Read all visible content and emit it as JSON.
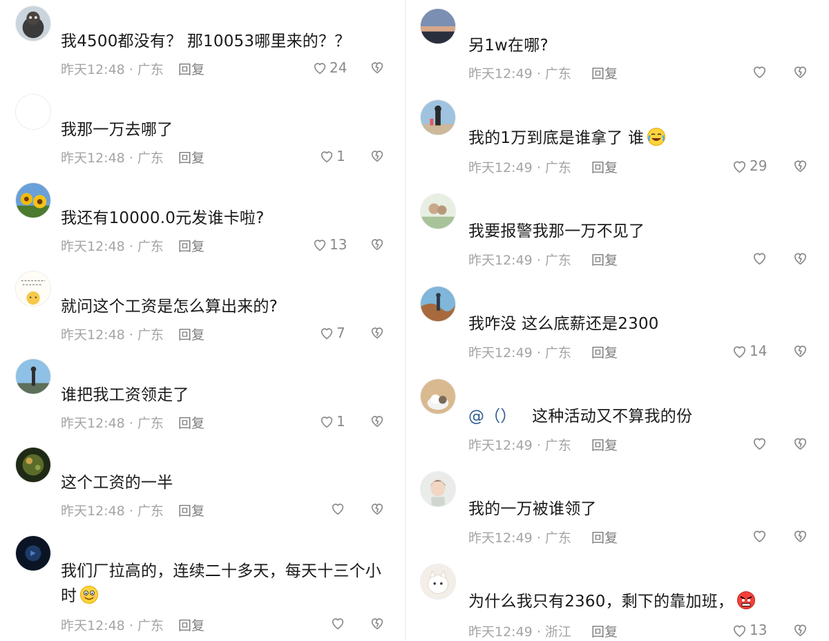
{
  "location_label_sep": "·",
  "reply_label": "回复",
  "left_comments": [
    {
      "text": "我4500都没有？  那10053哪里来的？？",
      "time": "昨天12:48",
      "region": "广东",
      "likes": "24"
    },
    {
      "text": "我那一万去哪了",
      "time": "昨天12:48",
      "region": "广东",
      "likes": "1"
    },
    {
      "text": "我还有10000.0元发谁卡啦?",
      "time": "昨天12:48",
      "region": "广东",
      "likes": "13"
    },
    {
      "text": "就问这个工资是怎么算出来的?",
      "time": "昨天12:48",
      "region": "广东",
      "likes": "7"
    },
    {
      "text": "谁把我工资领走了",
      "time": "昨天12:48",
      "region": "广东",
      "likes": "1"
    },
    {
      "text": "这个工资的一半",
      "time": "昨天12:48",
      "region": "广东",
      "likes": ""
    },
    {
      "text_line1": "我们厂拉高的，连续二十多天，每天十三个小",
      "text_line2": "时",
      "time": "昨天12:48",
      "region": "广东",
      "likes": ""
    }
  ],
  "right_comments": [
    {
      "text": "另1w在哪?",
      "time": "昨天12:49",
      "region": "广东",
      "likes": ""
    },
    {
      "text": "我的1万到底是谁拿了  谁",
      "time": "昨天12:49",
      "region": "广东",
      "likes": "29"
    },
    {
      "text": "我要报警我那一万不见了",
      "time": "昨天12:49",
      "region": "广东",
      "likes": ""
    },
    {
      "text": "我咋没 这么底薪还是2300",
      "time": "昨天12:49",
      "region": "广东",
      "likes": "14"
    },
    {
      "mention": "@（）",
      "text": "这种活动又不算我的份",
      "time": "昨天12:49",
      "region": "广东",
      "likes": ""
    },
    {
      "text": "我的一万被谁领了",
      "time": "昨天12:49",
      "region": "广东",
      "likes": ""
    },
    {
      "text": "为什么我只有2360，剩下的靠加班，",
      "time": "昨天12:49",
      "region": "浙江",
      "likes": "13"
    }
  ],
  "avatar_note": "handwritten text in avatar treated as image",
  "icon_names": [
    "heart-icon",
    "broken-heart-icon",
    "laughing-crying-emoji-icon",
    "smiling-emoji-icon",
    "angry-emoji-icon"
  ]
}
